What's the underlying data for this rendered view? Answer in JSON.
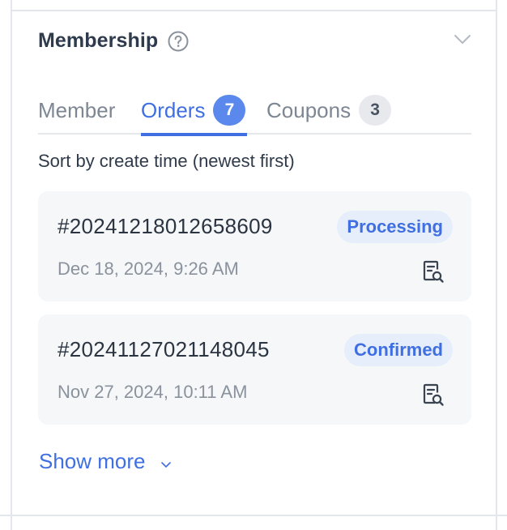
{
  "panel": {
    "title": "Membership",
    "help_icon": "question-circle-icon",
    "collapse_icon": "chevron-down-icon"
  },
  "tabs": [
    {
      "label": "Member",
      "active": false
    },
    {
      "label": "Orders",
      "badge": "7",
      "active": true
    },
    {
      "label": "Coupons",
      "badge": "3",
      "active": false
    }
  ],
  "sort_text": "Sort by create time (newest first)",
  "orders": [
    {
      "id": "#20241218012658609",
      "status": "Processing",
      "date": "Dec 18, 2024, 9:26 AM",
      "icon": "order-detail-search-icon"
    },
    {
      "id": "#20241127021148045",
      "status": "Confirmed",
      "date": "Nov 27, 2024, 10:11 AM",
      "icon": "order-detail-search-icon"
    }
  ],
  "show_more": {
    "label": "Show more",
    "icon": "chevron-down-icon"
  },
  "colors": {
    "accent": "#3f6fe0",
    "badge_active_bg": "#5a88ec",
    "status_bg": "#e6eefc",
    "card_bg": "#f6f7f9",
    "border": "#e3e6ea"
  }
}
